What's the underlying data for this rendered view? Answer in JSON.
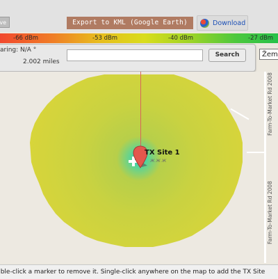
{
  "toolbar": {
    "save_label": "ave",
    "export_label": "Export to KML (Google Earth)",
    "download_label": "Download"
  },
  "legend": {
    "ticks": [
      "-66 dBm",
      "-53 dBm",
      "-40 dBm",
      "-27 dBm"
    ]
  },
  "info": {
    "bearing": "aring:  N/A °",
    "distance": "2.002 miles"
  },
  "search": {
    "value": "",
    "placeholder": "",
    "button_label": "Search"
  },
  "map_type": {
    "selected": "Žem"
  },
  "map": {
    "site_label": "TX Site 1",
    "road_labels": [
      "Farm-To-Market Rd 2008",
      "Farm-To-Market Rd 2008"
    ],
    "colors": {
      "coverage_outer": "#d7d63a",
      "coverage_mid": "#b2cf4e",
      "coverage_center": "#1cd3c9",
      "marker": "#e4574d",
      "radial_line": "#d9655b"
    }
  },
  "status": {
    "message": "uble-click a marker to remove it. Single-click anywhere on the map to add the TX Site"
  },
  "colors": {
    "accent_kml": "#b07b62",
    "link_blue": "#1b4fb6"
  }
}
